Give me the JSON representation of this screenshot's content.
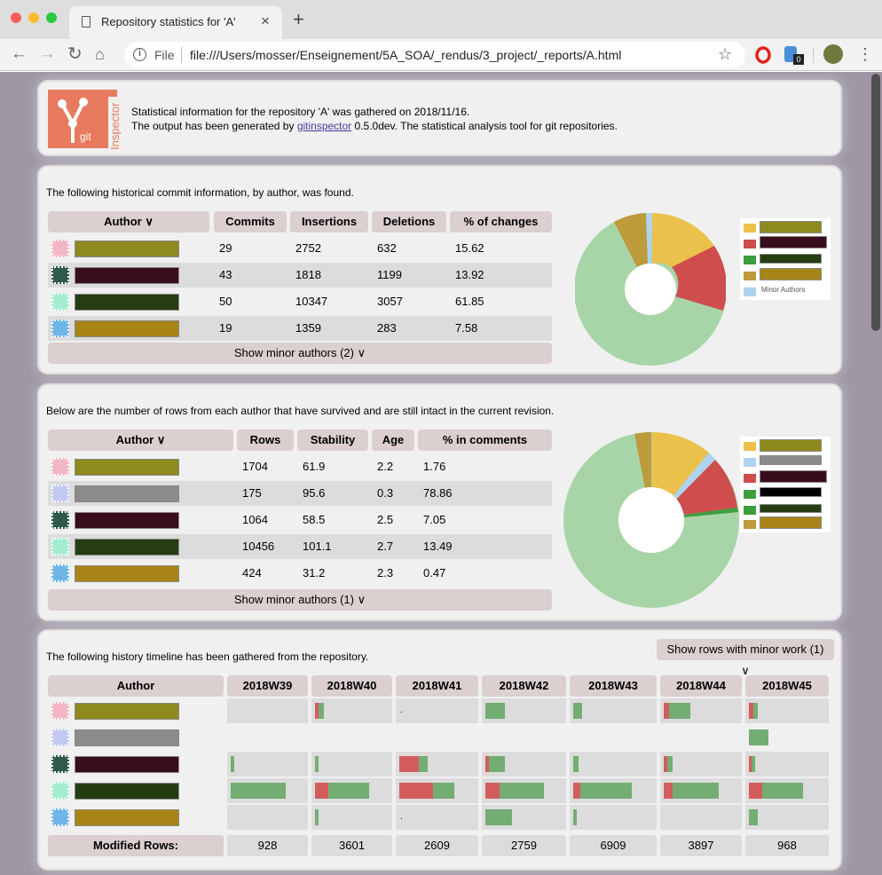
{
  "tab": {
    "title": "Repository statistics for 'A'"
  },
  "toolbar": {
    "scheme": "File",
    "url": "file:///Users/mosser/Enseignement/5A_SOA/_rendus/3_project/_reports/A.html",
    "ext_badge": "0"
  },
  "logo": {
    "vertical_text": "Inspector",
    "small_text": "git"
  },
  "intro": {
    "line1": "Statistical information for the repository 'A' was gathered on 2018/11/16.",
    "line2_pre": "The output has been generated by ",
    "line2_link": "gitinspector",
    "line2_post": " 0.5.0dev. The statistical analysis tool for git repositories."
  },
  "history": {
    "caption": "The following historical commit information, by author, was found.",
    "headers": [
      "Author ∨",
      "Commits",
      "Insertions",
      "Deletions",
      "% of changes"
    ],
    "rows": [
      {
        "commits": "29",
        "insertions": "2752",
        "deletions": "632",
        "pct": "15.62",
        "color": "#8f8a1d"
      },
      {
        "commits": "43",
        "insertions": "1818",
        "deletions": "1199",
        "pct": "13.92",
        "color": "#3a0d1e"
      },
      {
        "commits": "50",
        "insertions": "10347",
        "deletions": "3057",
        "pct": "61.85",
        "color": "#253d11"
      },
      {
        "commits": "19",
        "insertions": "1359",
        "deletions": "283",
        "pct": "7.58",
        "color": "#a88516"
      }
    ],
    "minor_button": "Show minor authors (2) ∨",
    "legend_minor": "Minor Authors"
  },
  "blame": {
    "caption": "Below are the number of rows from each author that have survived and are still intact in the current revision.",
    "headers": [
      "Author ∨",
      "Rows",
      "Stability",
      "Age",
      "% in comments"
    ],
    "rows": [
      {
        "rows": "1704",
        "stability": "61.9",
        "age": "2.2",
        "comments": "1.76",
        "color": "#8f8a1d"
      },
      {
        "rows": "175",
        "stability": "95.6",
        "age": "0.3",
        "comments": "78.86",
        "color": "#8b8b8b"
      },
      {
        "rows": "1064",
        "stability": "58.5",
        "age": "2.5",
        "comments": "7.05",
        "color": "#3a0d1e"
      },
      {
        "rows": "10456",
        "stability": "101.1",
        "age": "2.7",
        "comments": "13.49",
        "color": "#253d11"
      },
      {
        "rows": "424",
        "stability": "31.2",
        "age": "2.3",
        "comments": "0.47",
        "color": "#a88516"
      }
    ],
    "minor_button": "Show minor authors (1) ∨"
  },
  "timeline": {
    "caption": "The following history timeline has been gathered from the repository.",
    "minor_button": "Show rows with minor work (1) ∨",
    "author_header": "Author",
    "weeks": [
      "2018W39",
      "2018W40",
      "2018W41",
      "2018W42",
      "2018W43",
      "2018W44",
      "2018W45"
    ],
    "footer_label": "Modified Rows:",
    "modified": [
      "928",
      "3601",
      "2609",
      "2759",
      "6909",
      "3897",
      "968"
    ]
  },
  "colors": {
    "pie_yellow": "#ecc14b",
    "pie_red": "#cf4d4d",
    "pie_green": "#a8d5a8",
    "pie_gold": "#bd9a3a",
    "pie_blue": "#aed3ef"
  }
}
